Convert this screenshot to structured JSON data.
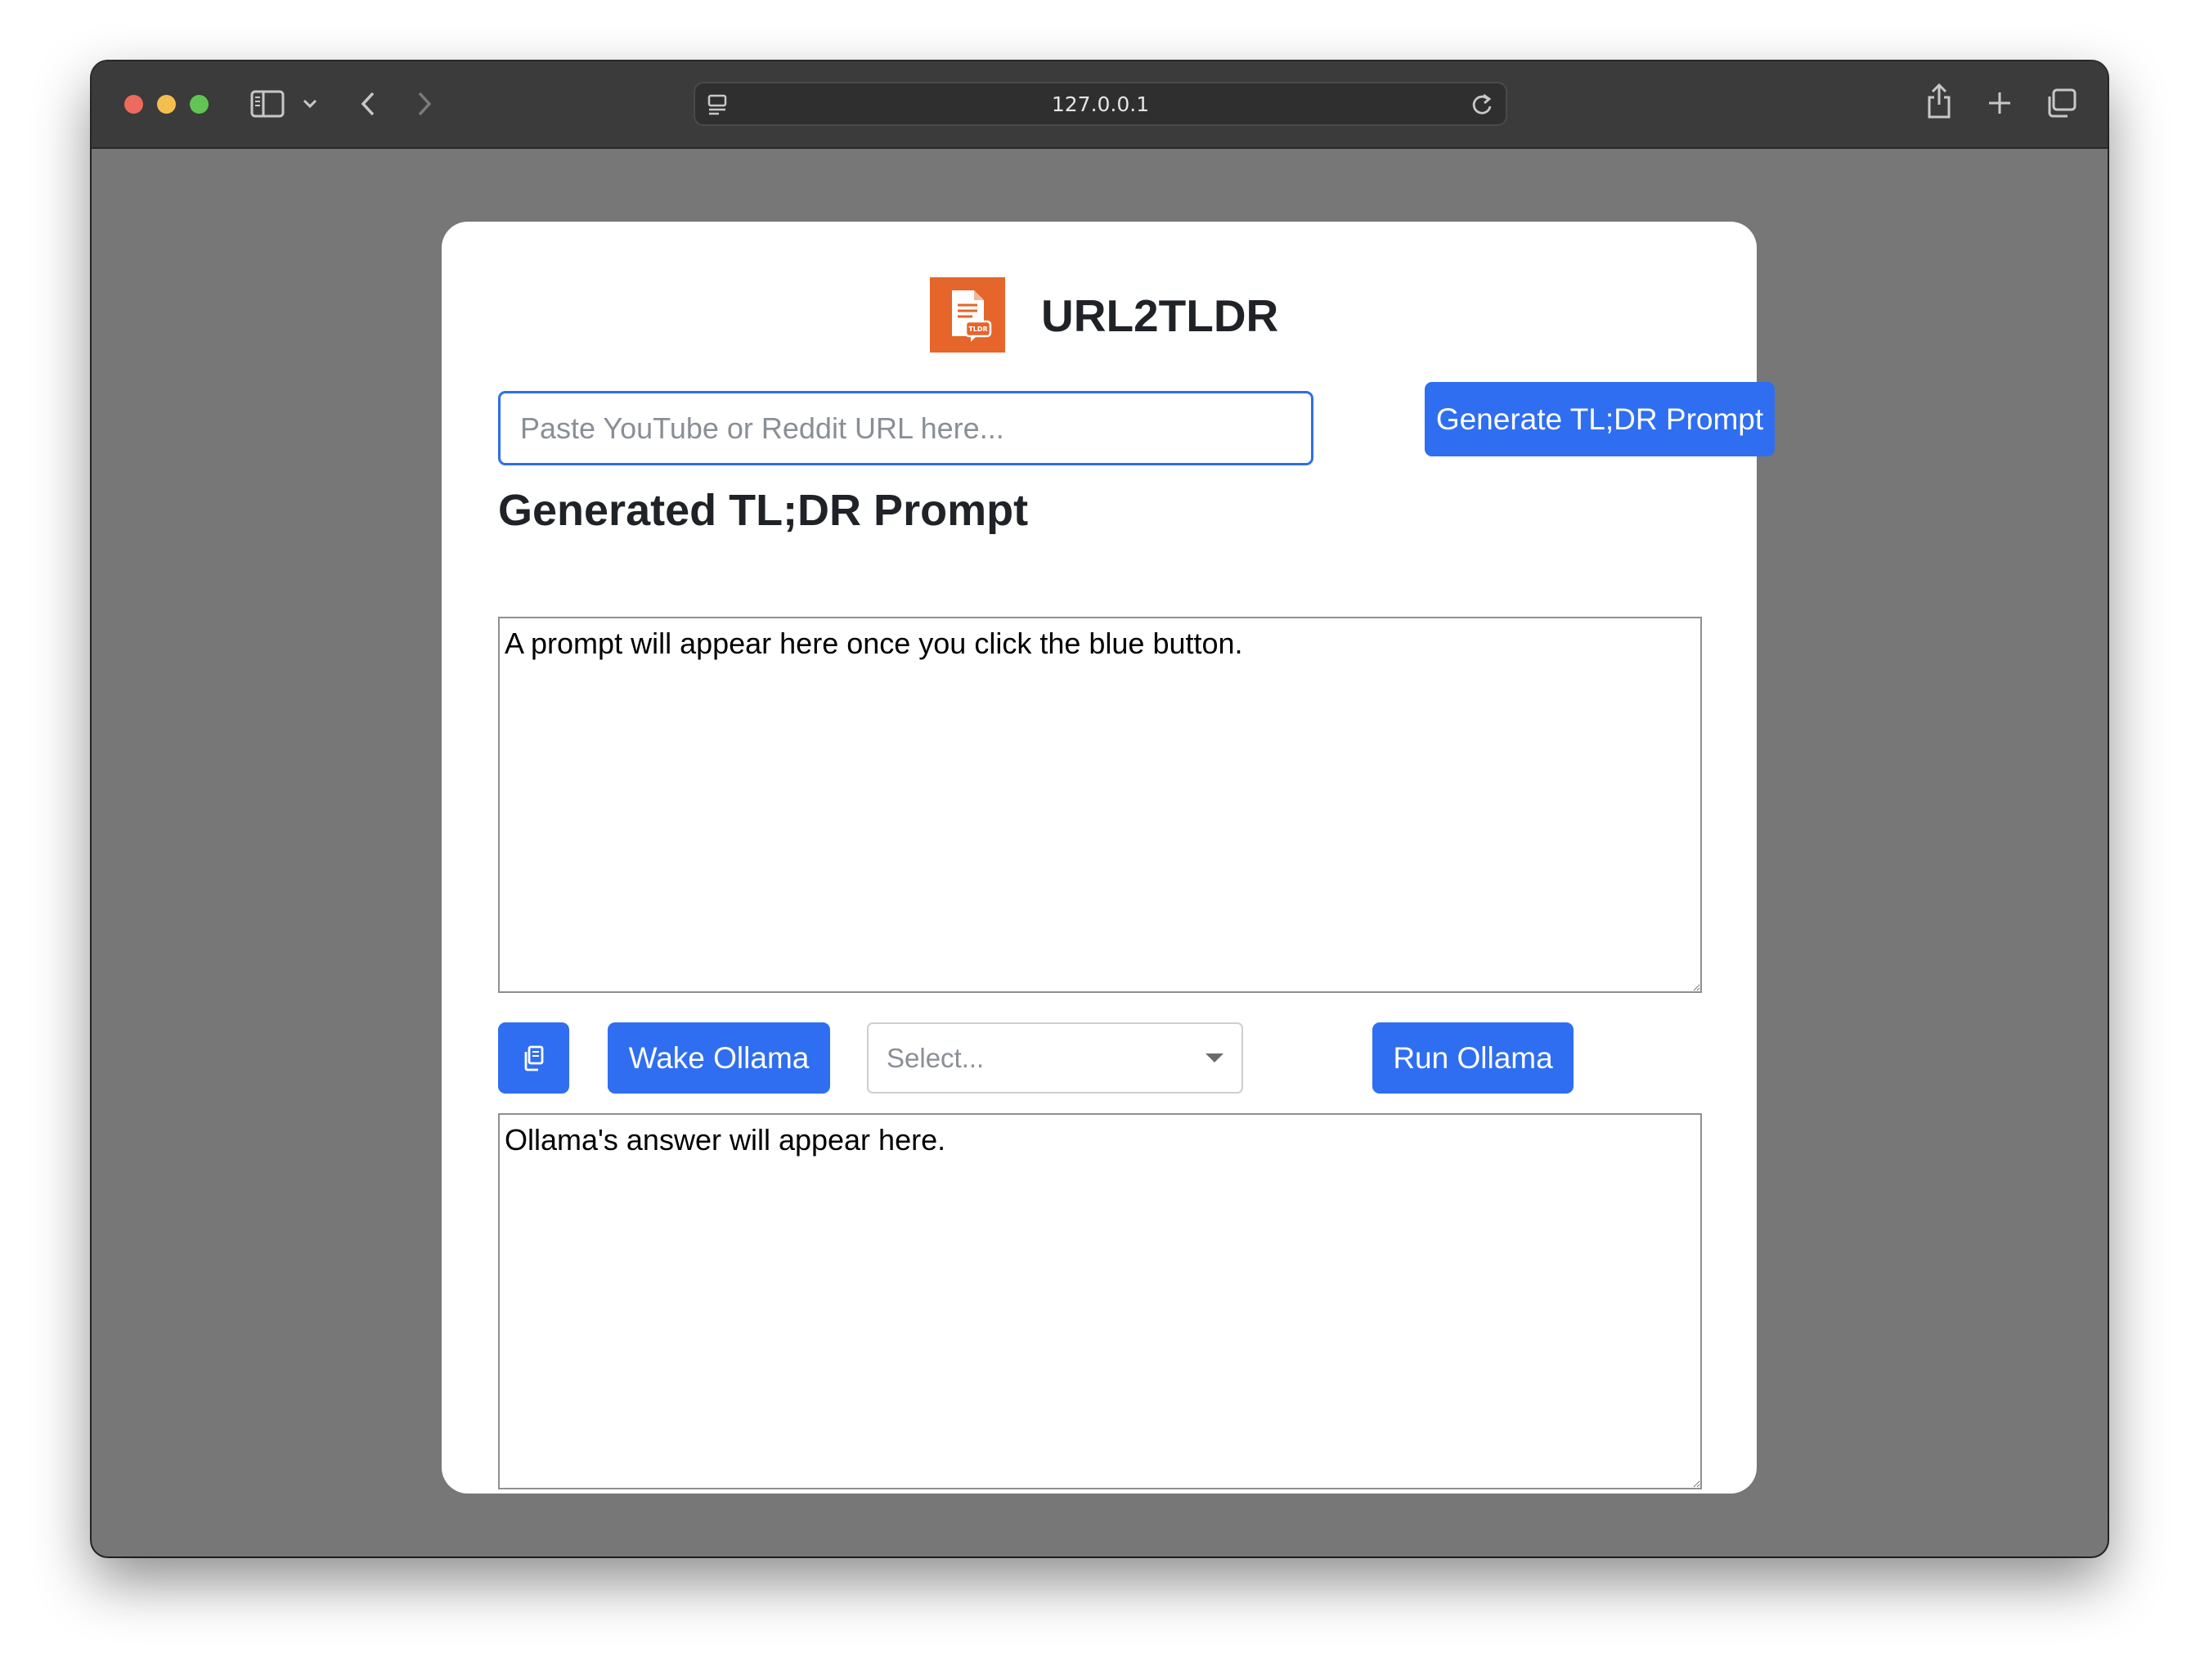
{
  "browser": {
    "address": "127.0.0.1"
  },
  "app": {
    "title": "URL2TLDR",
    "logo_icon": "tldr-document-icon",
    "accent_color": "#2f6ef0",
    "logo_color": "#e5652a"
  },
  "url_form": {
    "placeholder": "Paste YouTube or Reddit URL here...",
    "value": "",
    "generate_label": "Generate TL;DR Prompt"
  },
  "prompt_section": {
    "heading": "Generated TL;DR Prompt",
    "placeholder": "A prompt will appear here once you click the blue button."
  },
  "controls": {
    "copy_icon": "copy-icon",
    "wake_label": "Wake Ollama",
    "model_select_placeholder": "Select...",
    "run_label": "Run Ollama"
  },
  "answer_section": {
    "placeholder": "Ollama's answer will appear here."
  }
}
